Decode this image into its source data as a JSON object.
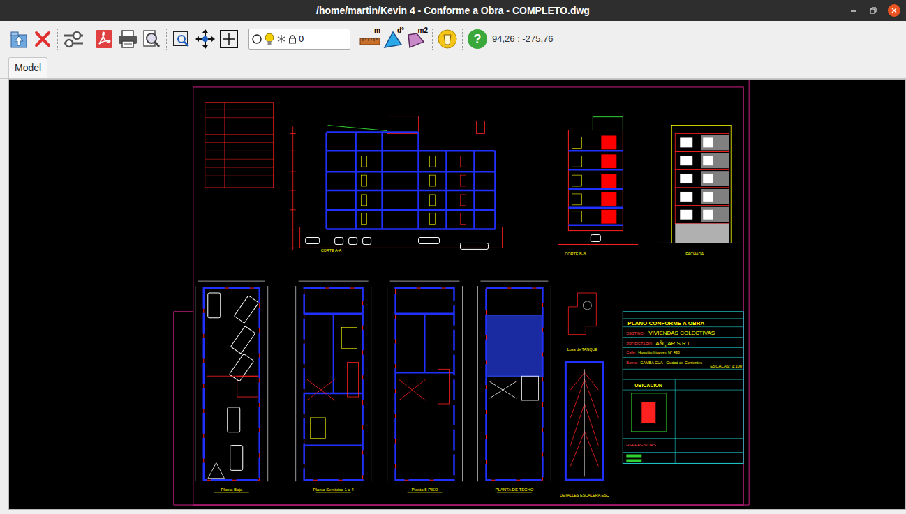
{
  "window": {
    "title": "/home/martin/Kevin 4 - Conforme a Obra - COMPLETO.dwg"
  },
  "toolbar": {
    "file_tools": [
      {
        "kind": "home"
      },
      {
        "kind": "close"
      }
    ],
    "settings_tools": [
      {
        "kind": "settings"
      }
    ],
    "output_tools": [
      {
        "kind": "pdf"
      },
      {
        "kind": "print"
      },
      {
        "kind": "preview"
      }
    ],
    "view_tools": [
      {
        "kind": "zoom-window"
      },
      {
        "kind": "pan"
      },
      {
        "kind": "zoom-extents"
      }
    ],
    "layer": {
      "name": "0"
    },
    "measure_tools": [
      {
        "kind": "distance",
        "label": "m"
      },
      {
        "kind": "angle",
        "label": "d°"
      },
      {
        "kind": "area",
        "label": "m2"
      }
    ],
    "extra_tools": [
      {
        "kind": "clear",
        "label": ""
      },
      {
        "kind": "help",
        "label": "?"
      }
    ],
    "coordinates": "94,26 : -275,76"
  },
  "tabs": [
    {
      "label": "Model",
      "selected": true
    }
  ],
  "drawing": {
    "views": {
      "corte_a": "CORTE A-A",
      "corte_b": "CORTE B-B",
      "fachada": "FACHADA",
      "planta_baja": "Planta Baja",
      "planta_semipiso": "Planta Semipiso 1 a 4",
      "planta_5": "Planta 5 PISO",
      "planta_techo": "PLANTA DE TECHO",
      "losa_tanque": "Losa de TANQUE",
      "escalera": "DETALLES ESCALERA ESC"
    },
    "title_block": {
      "heading": "PLANO CONFORME A OBRA",
      "destino_label": "DESTINO:",
      "destino": "VIVIENDAS COLECTIVAS",
      "propietario_label": "PROPIETARIO:",
      "propietario": "AÑÇAR S.R.L.",
      "calle_label": "Calle:",
      "calle": "Hugolito Irigoyen N° 430",
      "barrio_label": "Barrio:",
      "barrio": "CAMBA CUA - Ciudad de Corrientes",
      "escala": "ESCALAS: 1:100",
      "ubicacion": "UBICACION",
      "referencias": "REFERENCIAS"
    }
  }
}
